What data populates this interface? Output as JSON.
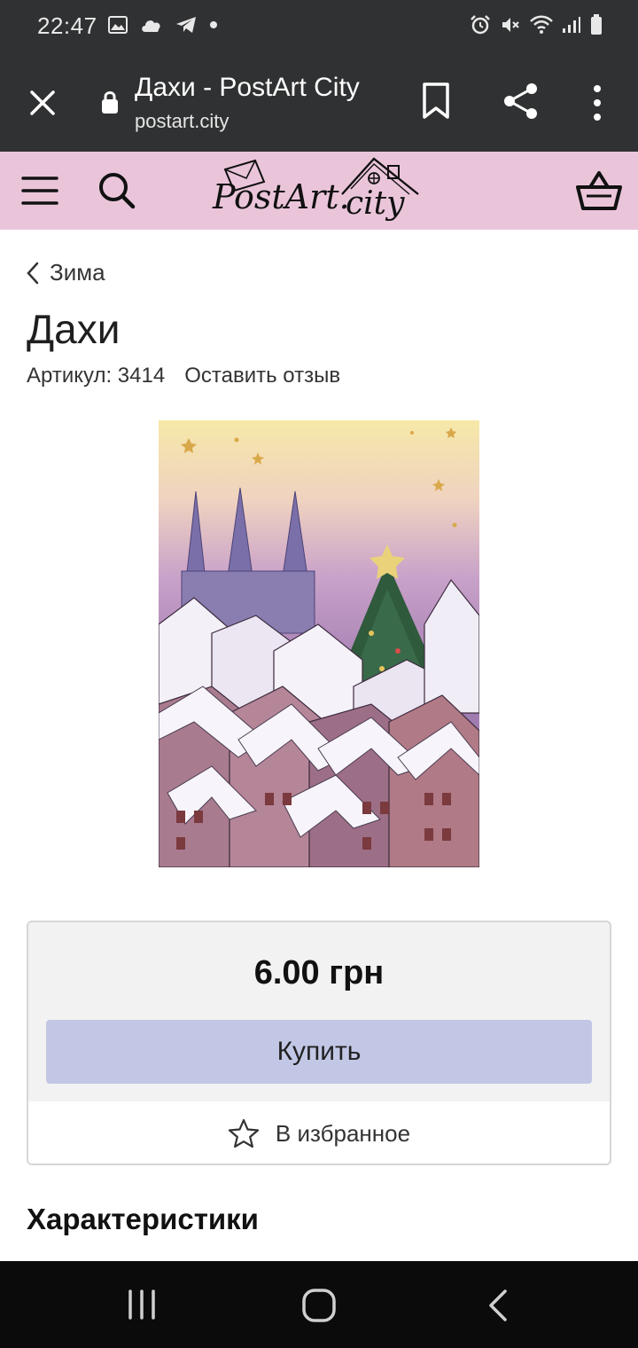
{
  "status_bar": {
    "time": "22:47",
    "left_icons": [
      "image-icon",
      "cloud-icon",
      "telegram-icon",
      "dot-icon"
    ],
    "right_icons": [
      "alarm-icon",
      "mute-icon",
      "wifi-icon",
      "signal-icon",
      "battery-icon"
    ]
  },
  "browser": {
    "title": "Дахи - PostArt City",
    "url": "postart.city"
  },
  "site": {
    "logo_text": "PostArt.city"
  },
  "breadcrumb": {
    "label": "Зима"
  },
  "product": {
    "title": "Дахи",
    "sku_label": "Артикул: 3414",
    "review_link": "Оставить отзыв",
    "image_icon": "winter-rooftops-painting"
  },
  "purchase": {
    "price": "6.00 грн",
    "buy_label": "Купить",
    "favorites_label": "В избранное"
  },
  "characteristics": {
    "title": "Характеристики"
  },
  "colors": {
    "header_pink": "#eac5da",
    "buy_button": "#c2c7e6",
    "browser_bar": "#303132"
  }
}
